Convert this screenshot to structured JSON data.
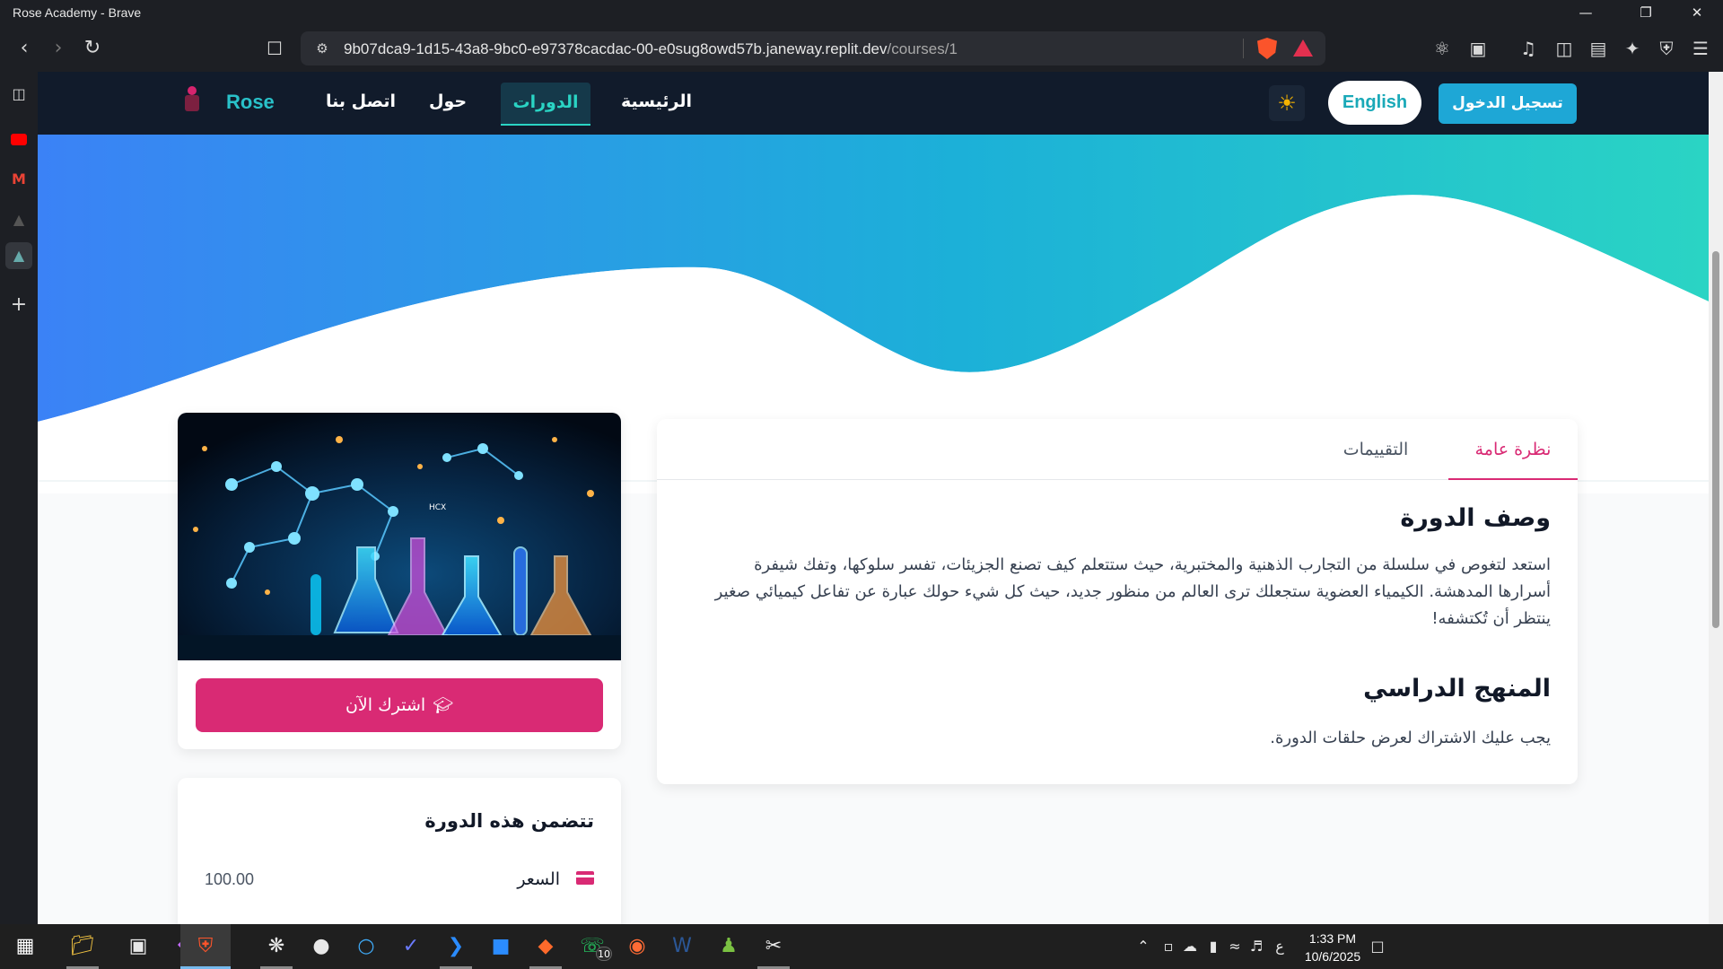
{
  "window": {
    "title": "Rose Academy - Brave",
    "controls": [
      "minimize",
      "restore",
      "close"
    ]
  },
  "toolbar": {
    "url_host": "9b07dca9-1d15-43a8-9bc0-e97378cacdac-00-e0sug8owd57b.janeway.replit.dev",
    "url_path": "/courses/1"
  },
  "sidebar": {
    "items": [
      "sidebar-toggle-icon",
      "youtube-icon",
      "gmail-icon",
      "app-icon",
      "app-icon",
      "add-icon"
    ]
  },
  "site": {
    "brand": "Rose",
    "nav": {
      "home": "الرئيسية",
      "courses": "الدورات",
      "about": "حول",
      "contact": "اتصل بنا"
    },
    "lang_button": "English",
    "login_button": "تسجيل الدخول",
    "colors": {
      "nav_bg": "#111b2b",
      "accent_teal": "#2ad4c4",
      "accent_pink": "#d92a74",
      "hero_from": "#3b82f6",
      "hero_to": "#2ad4c4"
    }
  },
  "course": {
    "subscribe_button": "اشترك الآن",
    "includes_title": "تتضمن هذه الدورة",
    "price_label": "السعر",
    "price_value": "100.00",
    "tabs": {
      "overview": "نظرة عامة",
      "reviews": "التقييمات"
    },
    "description_heading": "وصف الدورة",
    "description": "استعد لتغوص في سلسلة من التجارب الذهنية والمختبرية، حيث ستتعلم كيف تصنع الجزيئات، تفسر سلوكها، وتفك شيفرة أسرارها المدهشة. الكيمياء العضوية ستجعلك ترى العالم من منظور جديد، حيث كل شيء حولك عبارة عن تفاعل كيميائي صغير ينتظر أن تُكتشفه!",
    "curriculum_heading": "المنهج الدراسي",
    "curriculum_text": "يجب عليك الاشتراك لعرض حلقات الدورة.",
    "image_label": "HCX"
  },
  "taskbar": {
    "whatsapp_badge": "10",
    "tray_lang": "ع",
    "time": "1:33 PM",
    "date": "10/6/2025"
  }
}
